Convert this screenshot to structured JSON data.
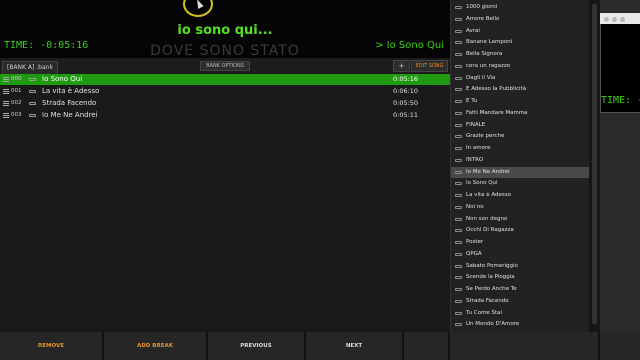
{
  "display": {
    "lyric": "io sono qui...",
    "timer": "TIME: -0:05:16",
    "ghost_title": "DOVE SONO STATO",
    "next_song": "> Io Sono Qui"
  },
  "toolbar": {
    "bank_tab": "[BANK A] .bank",
    "bank_options": "BANK OPTIONS",
    "plus": "+",
    "edit_songs": "EDIT SONG"
  },
  "playlist": [
    {
      "num": "000",
      "title": "Io Sono Qui",
      "duration": "0:05:16",
      "active": true
    },
    {
      "num": "001",
      "title": "La vita è Adesso",
      "duration": "0:06:10",
      "active": false
    },
    {
      "num": "002",
      "title": "Strada Facendo",
      "duration": "0:05:50",
      "active": false
    },
    {
      "num": "003",
      "title": "Io Me Ne Andrei",
      "duration": "0:05:11",
      "active": false
    }
  ],
  "library": {
    "items": [
      "1000 giorni",
      "Amore Bello",
      "Avrai",
      "Banane Lamponi",
      "Bella Signora",
      "cera un ragazzo",
      "Dagli il Via",
      "E Adesso la Pubblicità",
      "E Tu",
      "Fatti Mandare Mamma",
      "FINALE",
      "Grazie perche",
      "In amore",
      "INTRO",
      "Io Me Ne Andrei",
      "Io Sono Qui",
      "La vita è Adesso",
      "Noi no",
      "Non son degno",
      "Occhi Di Ragazza",
      "Poster",
      "QPGA",
      "Sabato Pomeriggio",
      "Scende la Pioggia",
      "Se Perdo Anche Te",
      "Strada Facendo",
      "Tu Come Stai",
      "Un Mondo D'Amore"
    ],
    "selected": "Io Me Ne Andrei"
  },
  "preview": {
    "time": "TIME: -"
  },
  "bottom_buttons": {
    "remove": "REMOVE",
    "add_break": "ADD BREAK",
    "previous": "PREVIOUS",
    "next": "NEXT"
  },
  "colors": {
    "lyric_green": "#55e21e",
    "active_row": "#1f9a11",
    "accent_orange": "#e8922a"
  }
}
